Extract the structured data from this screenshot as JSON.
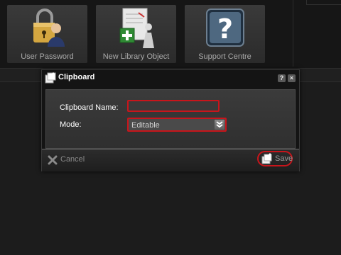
{
  "toolbar": {
    "tiles": [
      {
        "label": "User Password",
        "icon": "user-lock-icon"
      },
      {
        "label": "New Library Object",
        "icon": "library-object-icon"
      },
      {
        "label": "Support Centre",
        "icon": "help-icon"
      }
    ]
  },
  "dialog": {
    "title": "Clipboard",
    "help_icon_glyph": "?",
    "close_icon_glyph": "×",
    "fields": {
      "name_label": "Clipboard Name:",
      "name_value": "",
      "mode_label": "Mode:",
      "mode_value": "Editable"
    },
    "buttons": {
      "cancel": "Cancel",
      "save": "Save"
    }
  },
  "colors": {
    "background": "#1c1c1c",
    "highlight": "#c8151b",
    "dialog_body": "#353535"
  }
}
